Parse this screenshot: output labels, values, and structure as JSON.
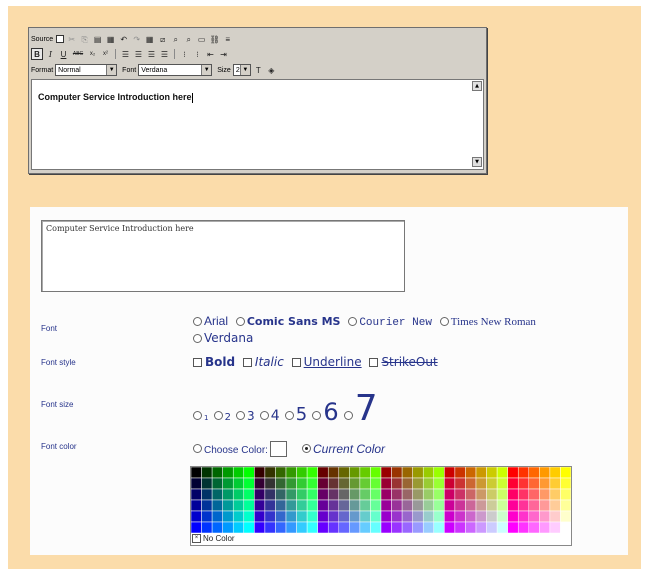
{
  "editor": {
    "toolbar1": {
      "source_label": "Source",
      "icons": [
        "cut-icon",
        "copy-icon",
        "paste-icon",
        "paste-word-icon",
        "undo-icon",
        "redo-icon",
        "table-icon",
        "image-icon",
        "find-icon",
        "replace-icon",
        "rule-icon",
        "link-icon",
        "unlink-icon"
      ]
    },
    "toolbar2": {
      "bold": "B",
      "italic": "I",
      "underline": "U",
      "strike": "ABC",
      "subscript": "x₂",
      "superscript": "x²"
    },
    "toolbar3": {
      "format_label": "Format",
      "format_value": "Normal",
      "font_label": "Font",
      "font_value": "Verdana",
      "size_label": "Size",
      "size_value": "2"
    },
    "content": "Computer Service Introduction here"
  },
  "form": {
    "preview_text": "Computer Service Introduction here",
    "labels": {
      "font": "Font",
      "font_style": "Font style",
      "font_size": "Font size",
      "font_color": "Font color"
    },
    "fonts": [
      "Arial",
      "Comic Sans MS",
      "Courier New",
      "Times New Roman",
      "Verdana"
    ],
    "styles": {
      "bold": "Bold",
      "italic": "Italic",
      "underline": "Underline",
      "strikeout": "StrikeOut"
    },
    "sizes": [
      "1",
      "2",
      "3",
      "4",
      "5",
      "6",
      "7"
    ],
    "color": {
      "choose": "Choose Color:",
      "current": "Current Color",
      "selected": "current"
    },
    "no_color": "No Color"
  }
}
